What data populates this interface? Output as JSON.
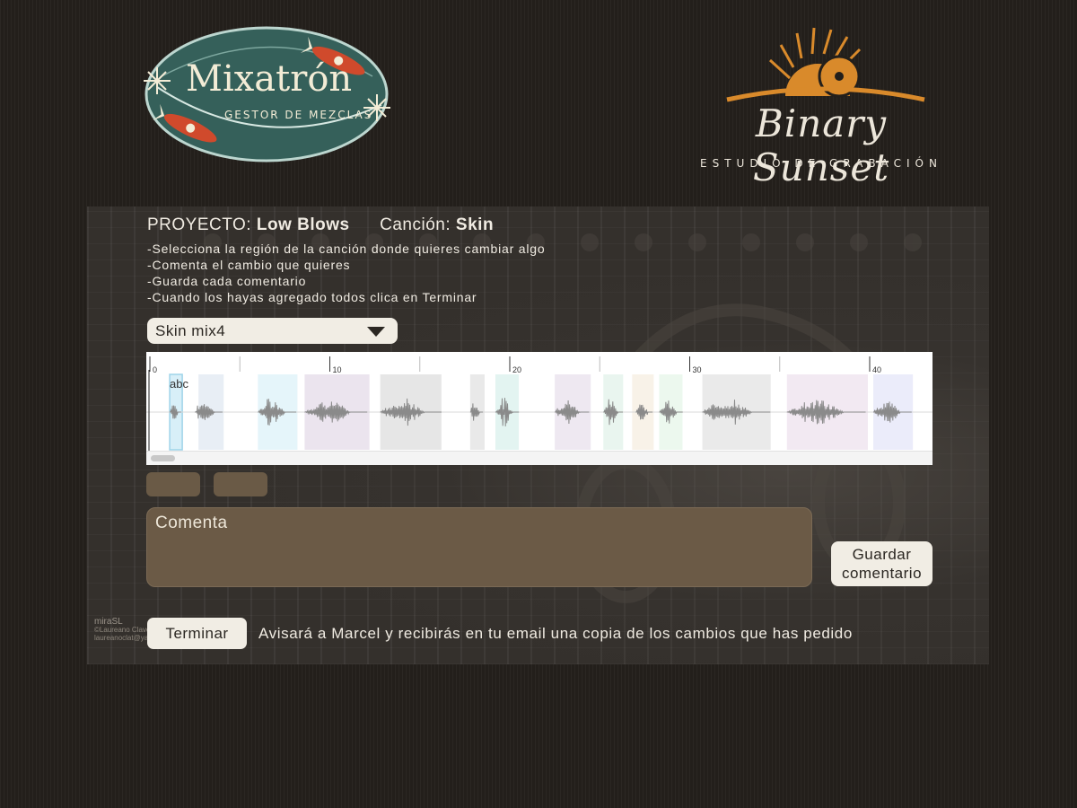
{
  "logos": {
    "mixatron": {
      "title": "Mixatrón",
      "subtitle": "GESTOR DE MEZCLAS",
      "bg_color": "#35605a"
    },
    "studio": {
      "title": "Binary Sunset",
      "subtitle": "ESTUDIO DE GRABACIÓN",
      "accent": "#d98a2b"
    }
  },
  "project": {
    "project_label": "PROYECTO:",
    "project_name": "Low Blows",
    "song_label": "Canción:",
    "song_name": "Skin"
  },
  "instructions": [
    "-Selecciona la región de la canción donde quieres cambiar algo",
    "-Comenta el cambio que quieres",
    "-Guarda cada comentario",
    "-Cuando los hayas agregado todos clica en Terminar"
  ],
  "mix_select": {
    "selected": "Skin mix4"
  },
  "waveform": {
    "timeline_labels": [
      "0",
      "10",
      "20",
      "30",
      "40"
    ],
    "region_label": "abc",
    "regions": [
      {
        "start": 1.1,
        "end": 1.8,
        "color": "#bfe6f4",
        "selected": true
      },
      {
        "start": 2.7,
        "end": 4.1,
        "color": "#d8e2ee"
      },
      {
        "start": 6.0,
        "end": 8.2,
        "color": "#d3eef6"
      },
      {
        "start": 8.6,
        "end": 12.2,
        "color": "#ddd2e2"
      },
      {
        "start": 12.8,
        "end": 16.2,
        "color": "#d6d6d6"
      },
      {
        "start": 17.8,
        "end": 18.6,
        "color": "#dadada"
      },
      {
        "start": 19.2,
        "end": 20.5,
        "color": "#d1ece8"
      },
      {
        "start": 22.5,
        "end": 24.5,
        "color": "#e2d8e8"
      },
      {
        "start": 25.2,
        "end": 26.3,
        "color": "#dbeee5"
      },
      {
        "start": 26.8,
        "end": 28.0,
        "color": "#f4ead8"
      },
      {
        "start": 28.3,
        "end": 29.6,
        "color": "#e0f3e3"
      },
      {
        "start": 30.7,
        "end": 34.5,
        "color": "#dcdcdc"
      },
      {
        "start": 35.4,
        "end": 39.9,
        "color": "#e9dbe9"
      },
      {
        "start": 40.2,
        "end": 42.4,
        "color": "#dde0f6"
      }
    ],
    "audio_bursts": [
      {
        "start": 1.1,
        "end": 1.7
      },
      {
        "start": 2.5,
        "end": 4.0
      },
      {
        "start": 6.0,
        "end": 8.1
      },
      {
        "start": 8.6,
        "end": 12.1
      },
      {
        "start": 12.8,
        "end": 16.2
      },
      {
        "start": 17.8,
        "end": 18.5
      },
      {
        "start": 19.2,
        "end": 20.5
      },
      {
        "start": 22.5,
        "end": 24.4
      },
      {
        "start": 25.2,
        "end": 26.3
      },
      {
        "start": 27.0,
        "end": 27.9
      },
      {
        "start": 28.3,
        "end": 29.6
      },
      {
        "start": 30.7,
        "end": 34.5
      },
      {
        "start": 35.4,
        "end": 39.8
      },
      {
        "start": 40.2,
        "end": 42.3
      }
    ],
    "total_seconds": 43.5
  },
  "comment": {
    "placeholder": "Comenta"
  },
  "buttons": {
    "save_label_line1": "Guardar",
    "save_label_line2": "comentario",
    "finish_label": "Terminar"
  },
  "finish_note": "Avisará a Marcel y recibirás en tu email una copia de los cambios que has pedido",
  "credit": {
    "line1": "miraSL",
    "line2": "©Laureano Clavero",
    "line3": "laureanoclat@yahoo.es"
  }
}
